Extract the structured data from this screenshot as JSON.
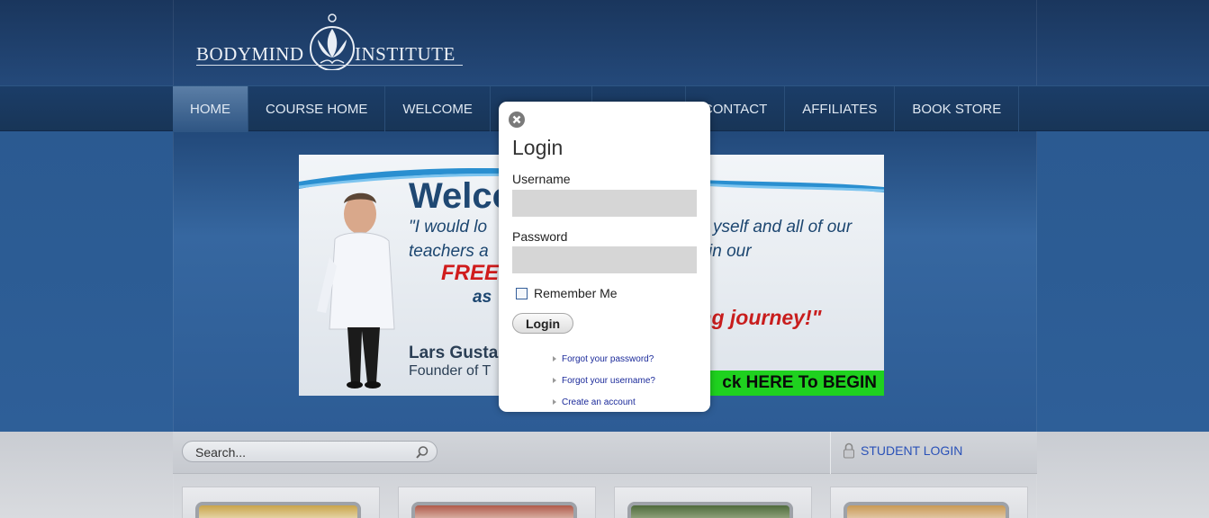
{
  "header": {
    "logo_left": "BODYMIND",
    "logo_right": "INSTITUTE"
  },
  "nav": {
    "items": [
      {
        "label": "HOME",
        "active": true
      },
      {
        "label": "COURSE HOME",
        "active": false
      },
      {
        "label": "WELCOME",
        "active": false
      },
      {
        "label": "",
        "active": false
      },
      {
        "label": "",
        "active": false
      },
      {
        "label": "CONTACT",
        "active": false
      },
      {
        "label": "AFFILIATES",
        "active": false
      },
      {
        "label": "BOOK STORE",
        "active": false
      }
    ]
  },
  "banner": {
    "welcome": "Welco",
    "quote_line1": "\"I would lo",
    "quote_line1_right": "yself and all of our",
    "quote_line2": "teachers a",
    "quote_line2_right": "in our",
    "free": "FREE",
    "as": "as",
    "journey": "ing journey!\"",
    "name": "Lars Gusta",
    "founder": "Founder of T",
    "cta": "ck HERE To BEGIN"
  },
  "toolbar": {
    "search_placeholder": "Search...",
    "student_login": "STUDENT LOGIN"
  },
  "modal": {
    "title": "Login",
    "username_label": "Username",
    "username_value": "",
    "password_label": "Password",
    "password_value": "",
    "remember_label": "Remember Me",
    "remember_checked": false,
    "login_button": "Login",
    "links": {
      "forgot_password": "Forgot your password?",
      "forgot_username": "Forgot your username?",
      "create_account": "Create an account"
    }
  },
  "colors": {
    "nav_bg": "#1b3d68",
    "banner_bg": "#2e5f98",
    "cta_green": "#1fd11f",
    "free_red": "#d01c1c",
    "link_blue": "#2a52b8"
  }
}
